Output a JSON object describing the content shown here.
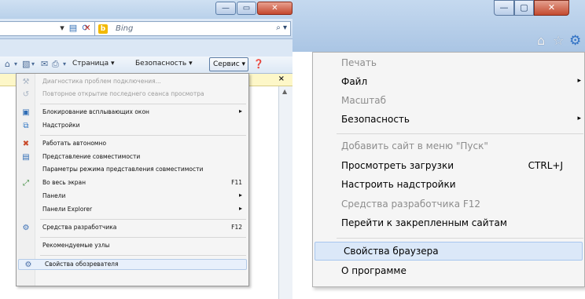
{
  "left": {
    "window_buttons": {
      "minimize": "—",
      "maximize": "▭",
      "close": "✕"
    },
    "search": {
      "value": "Bing",
      "go_icon": "search-icon"
    },
    "commandbar": {
      "page_label": "Страница ▾",
      "security_label": "Безопасность ▾",
      "tools_label": "Сервис ▾",
      "help_icon": "help-icon"
    },
    "infobar_close": "×",
    "menu": {
      "items": [
        {
          "label": "Диагностика проблем подключения...",
          "icon": "diagnostics-icon",
          "disabled": true
        },
        {
          "label": "Повторное открытие последнего сеанса просмотра",
          "icon": "reopen-session-icon",
          "disabled": true
        },
        {
          "label": "Блокирование всплывающих окон",
          "icon": "popup-blocker-icon",
          "arrow": "▸"
        },
        {
          "label": "Надстройки",
          "icon": "addons-icon"
        },
        {
          "label": "Работать автономно",
          "icon": "offline-icon"
        },
        {
          "label": "Представление совместимости",
          "icon": "compatibility-icon"
        },
        {
          "label": "Параметры режима представления совместимости",
          "icon": ""
        },
        {
          "label": "Во весь экран",
          "icon": "fullscreen-icon",
          "shortcut": "F11"
        },
        {
          "label": "Панели",
          "icon": "",
          "arrow": "▸"
        },
        {
          "label": "Панели Explorer",
          "icon": "",
          "arrow": "▸"
        },
        {
          "label": "Средства разработчика",
          "icon": "developer-tools-icon",
          "shortcut": "F12"
        },
        {
          "label": "Рекомендуемые узлы",
          "icon": ""
        },
        {
          "label": "Свойства обозревателя",
          "icon": "internet-options-icon",
          "highlighted": true
        }
      ]
    }
  },
  "right": {
    "window_buttons": {
      "minimize": "—",
      "maximize": "▢",
      "close": "✕"
    },
    "toolbar_icons": [
      "home-icon",
      "favorites-star-icon",
      "tools-gear-icon"
    ],
    "menu": {
      "items": [
        {
          "label": "Печать",
          "disabled": true
        },
        {
          "label": "Файл",
          "arrow": "▸"
        },
        {
          "label": "Масштаб",
          "disabled": true
        },
        {
          "label": "Безопасность",
          "arrow": "▸"
        },
        {
          "label": "Добавить сайт в меню \"Пуск\"",
          "disabled": true
        },
        {
          "label": "Просмотреть загрузки",
          "shortcut": "CTRL+J"
        },
        {
          "label": "Настроить надстройки"
        },
        {
          "label": "Средства разработчика F12",
          "disabled": true
        },
        {
          "label": "Перейти к закрепленным сайтам"
        },
        {
          "label": "Свойства браузера",
          "highlighted": true
        },
        {
          "label": "О программе"
        }
      ]
    }
  }
}
